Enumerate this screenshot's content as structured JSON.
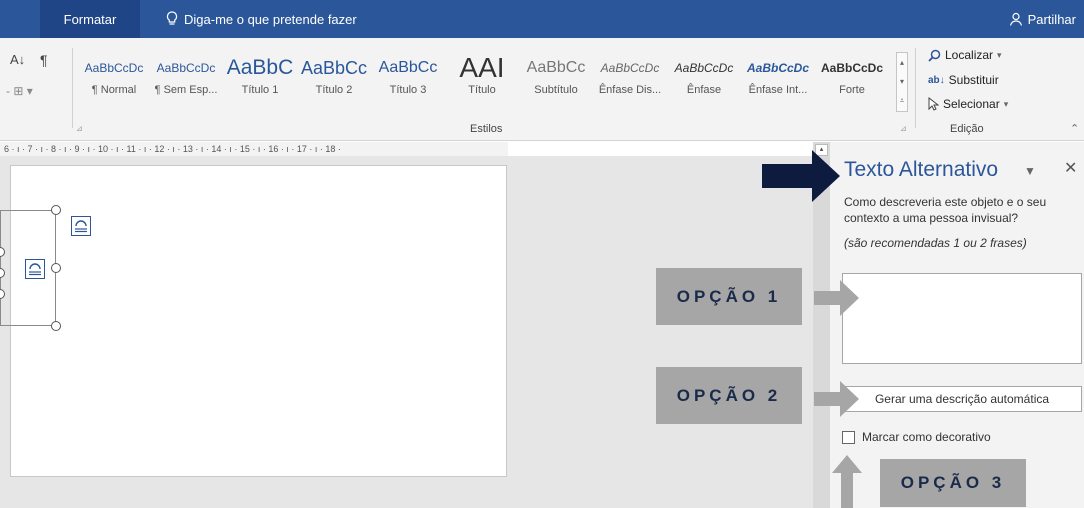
{
  "titlebar": {
    "tab_format": "Formatar",
    "tell_me": "Diga-me o que pretende fazer",
    "share": "Partilhar"
  },
  "ribbon": {
    "styles": [
      {
        "preview": "AaBbCcDc",
        "name": "¶ Normal"
      },
      {
        "preview": "AaBbCcDc",
        "name": "¶ Sem Esp..."
      },
      {
        "preview": "AaBbC",
        "name": "Título 1"
      },
      {
        "preview": "AaBbCc",
        "name": "Título 2"
      },
      {
        "preview": "AaBbCc",
        "name": "Título 3"
      },
      {
        "preview": "AAI",
        "name": "Título"
      },
      {
        "preview": "AaBbCc",
        "name": "Subtítulo"
      },
      {
        "preview": "AaBbCcDc",
        "name": "Ênfase Dis..."
      },
      {
        "preview": "AaBbCcDc",
        "name": "Ênfase"
      },
      {
        "preview": "AaBbCcDc",
        "name": "Ênfase Int..."
      },
      {
        "preview": "AaBbCcDc",
        "name": "Forte"
      }
    ],
    "styles_label": "Estilos",
    "editing": {
      "find": "Localizar",
      "replace": "Substituir",
      "select": "Selecionar",
      "label": "Edição"
    }
  },
  "ruler": {
    "text": "6 · ı · 7 · ı · 8 · ı · 9 · ı · 10 · ı · 11 · ı · 12 · ı · 13 · ı · 14 · ı · 15 · ı · 16 · ı · 17 · ı · 18 ·"
  },
  "pane": {
    "title": "Texto Alternativo",
    "prompt": "Como descreveria este objeto e o seu contexto a uma pessoa invisual?",
    "recommendation": "(são recomendadas 1 ou 2 frases)",
    "alt_text_value": "",
    "generate_button": "Gerar uma descrição automática",
    "decorative_label": "Marcar como decorativo",
    "decorative_checked": false
  },
  "callouts": {
    "option1": "OPÇÃO 1",
    "option2": "OPÇÃO 2",
    "option3": "OPÇÃO 3"
  },
  "colors": {
    "brand_blue": "#2b579a",
    "arrow_navy": "#0d1b3e",
    "callout_gray": "#a6a6a6"
  }
}
